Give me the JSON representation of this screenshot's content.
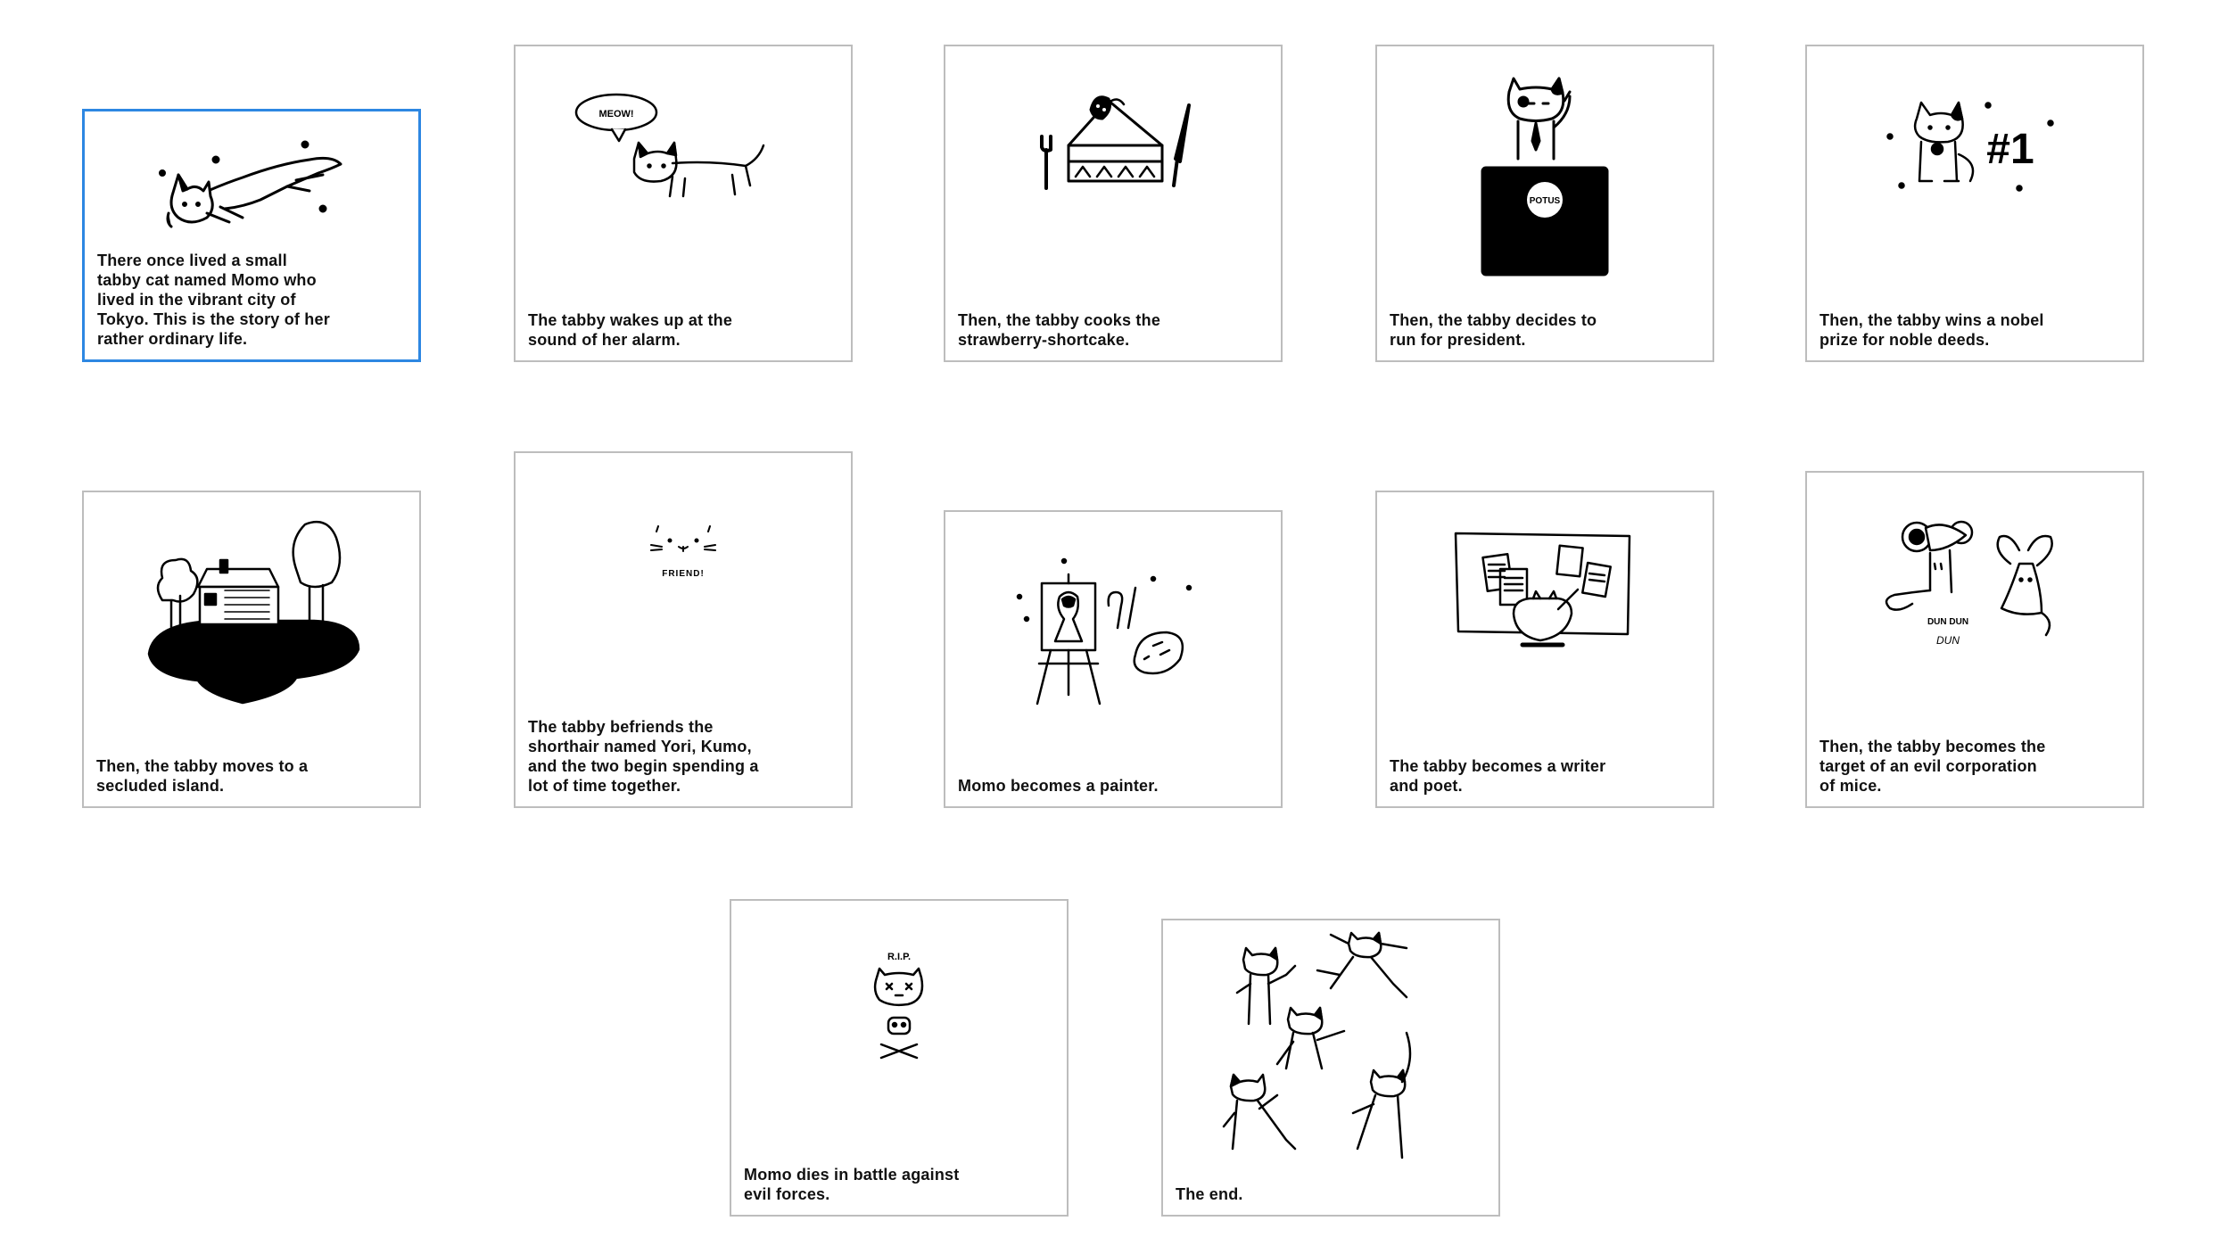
{
  "cards": [
    {
      "caption": "There once lived a small\ntabby cat named Momo who\nlived in the vibrant city of\nTokyo. This is the story of her\nrather ordinary life.",
      "illustration": "cat-leaping-icon",
      "selected": true
    },
    {
      "caption": "The tabby wakes up at the\nsound of her alarm.",
      "illustration": "cat-meowing-icon",
      "speech_bubble": "MEOW!"
    },
    {
      "caption": "Then, the tabby cooks the\nstrawberry-shortcake.",
      "illustration": "cake-slice-icon"
    },
    {
      "caption": "Then, the tabby decides to\nrun for president.",
      "illustration": "cat-podium-icon",
      "podium_label": "POTUS"
    },
    {
      "caption": "Then, the tabby wins a nobel\nprize for noble deeds.",
      "illustration": "cat-medal-icon",
      "badge": "#1"
    },
    {
      "caption": "Then, the tabby moves to a\nsecluded island.",
      "illustration": "island-house-icon"
    },
    {
      "caption": "The tabby befriends the\nshorthair named Yori, Kumo,\nand the two begin spending a\nlot of time together.",
      "illustration": "cat-face-icon",
      "label": "FRIEND!"
    },
    {
      "caption": "Momo becomes a painter.",
      "illustration": "easel-painting-icon"
    },
    {
      "caption": "The tabby becomes a writer\nand poet.",
      "illustration": "writing-desk-icon"
    },
    {
      "caption": "Then, the tabby becomes the\ntarget of an evil corporation\nof mice.",
      "illustration": "mice-icon",
      "label_top": "DUN DUN",
      "label_bottom": "DUN"
    },
    {
      "caption": "Momo dies in battle against\nevil forces.",
      "illustration": "skull-crossbones-icon",
      "label": "R.I.P."
    },
    {
      "caption": "The end.",
      "illustration": "dancing-cats-icon"
    }
  ]
}
